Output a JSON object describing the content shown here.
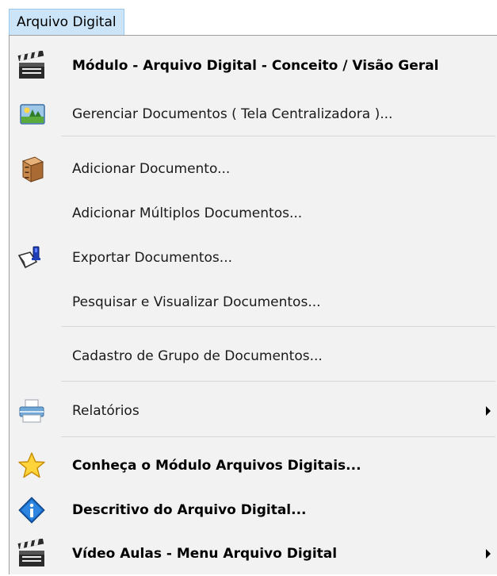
{
  "menubar": {
    "title": "Arquivo Digital"
  },
  "menu": {
    "items": [
      {
        "label": "Módulo - Arquivo Digital - Conceito / Visão Geral",
        "icon": "clapperboard-icon",
        "bold": true
      },
      {
        "label": "Gerenciar Documentos ( Tela Centralizadora )...",
        "icon": "picture-icon",
        "bold": false
      },
      {
        "label": "Adicionar Documento...",
        "icon": "filing-cabinet-icon",
        "bold": false
      },
      {
        "label": "Adicionar Múltiplos Documentos...",
        "icon": "",
        "bold": false
      },
      {
        "label": "Exportar Documentos...",
        "icon": "export-icon",
        "bold": false
      },
      {
        "label": "Pesquisar e Visualizar Documentos...",
        "icon": "",
        "bold": false
      },
      {
        "label": "Cadastro de Grupo de Documentos...",
        "icon": "",
        "bold": false
      },
      {
        "label": "Relatórios",
        "icon": "printer-icon",
        "bold": false,
        "submenu": true
      },
      {
        "label": "Conheça o Módulo Arquivos Digitais...",
        "icon": "star-icon",
        "bold": true
      },
      {
        "label": "Descritivo do Arquivo Digital...",
        "icon": "info-icon",
        "bold": true
      },
      {
        "label": "Vídeo Aulas - Menu Arquivo Digital",
        "icon": "clapperboard-icon",
        "bold": true,
        "submenu": true
      }
    ]
  }
}
